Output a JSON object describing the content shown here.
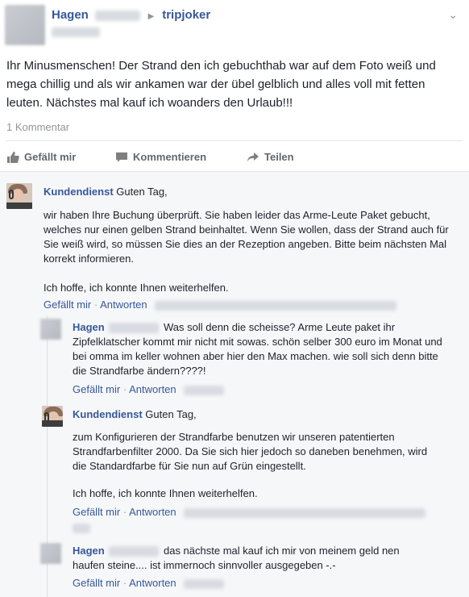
{
  "post": {
    "author": "Hagen",
    "target": "tripjoker",
    "text": "Ihr Minusmenschen! Der Strand den ich gebuchthab war auf dem Foto weiß und mega chillig und als wir ankamen war der übel gelblich und alles voll mit fetten leuten. Nächstes mal kauf ich woanders den Urlaub!!!",
    "comment_count": "1 Kommentar"
  },
  "actions": {
    "like": "Gefällt mir",
    "comment": "Kommentieren",
    "share": "Teilen"
  },
  "comments": [
    {
      "name": "Kundendienst",
      "greeting": "Guten Tag,",
      "paragraphs": [
        "wir haben Ihre Buchung überprüft. Sie haben leider das Arme-Leute Paket gebucht, welches nur einen gelben Strand beinhaltet. Wenn Sie wollen, dass der Strand auch für Sie weiß wird, so müssen Sie dies an der Rezeption angeben. Bitte beim nächsten Mal korrekt informieren.",
        "Ich hoffe, ich konnte Ihnen weiterhelfen."
      ],
      "like": "Gefällt mir",
      "reply": "Antworten"
    }
  ],
  "replies": [
    {
      "name": "Hagen",
      "text": "Was soll denn die scheisse? Arme Leute paket ihr Zipfelklatscher kommt mir nicht mit sowas. schön selber 300 euro im Monat und bei omma im keller wohnen aber hier den Max machen. wie soll sich denn bitte die Strandfarbe ändern????!",
      "like": "Gefällt mir",
      "reply": "Antworten"
    },
    {
      "name": "Kundendienst",
      "greeting": "Guten Tag,",
      "paragraphs": [
        "zum Konfigurieren der Strandfarbe benutzen wir unseren patentierten Strandfarbenfilter 2000. Da Sie sich hier jedoch so daneben benehmen, wird die Standardfarbe für Sie nun auf Grün eingestellt.",
        "Ich hoffe, ich konnte Ihnen weiterhelfen."
      ],
      "like": "Gefällt mir",
      "reply": "Antworten"
    },
    {
      "name": "Hagen",
      "text": "das nächste mal kauf ich mir von meinem geld nen haufen steine.... ist immernoch sinnvoller ausgegeben -.-",
      "like": "Gefällt mir",
      "reply": "Antworten"
    }
  ],
  "separator": "·",
  "colors": {
    "link": "#365899",
    "muted": "#90949c",
    "comments_bg": "#f6f7f9"
  },
  "icons": [
    "arrow-right-icon",
    "chevron-down-icon",
    "thumbs-up-icon",
    "comment-bubble-icon",
    "share-arrow-icon"
  ]
}
